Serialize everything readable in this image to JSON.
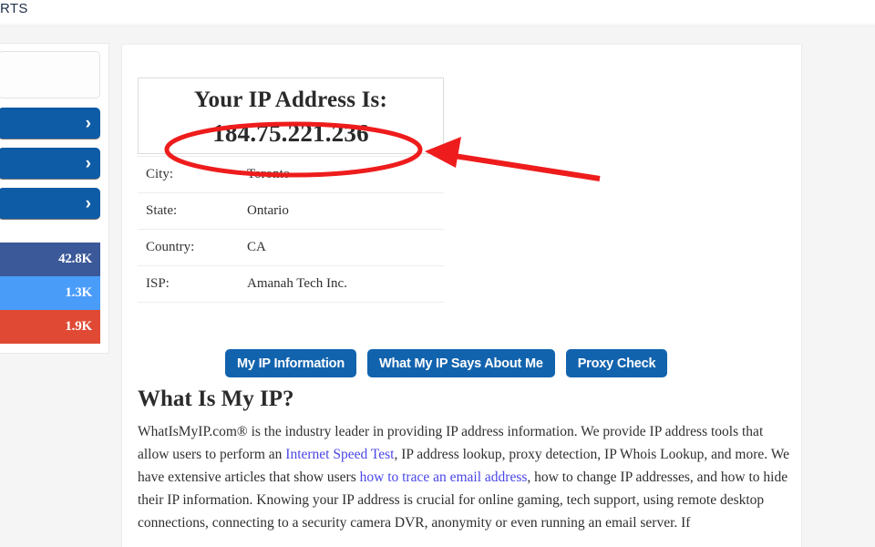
{
  "topbar": {
    "text": "RTS"
  },
  "sidebar": {
    "ad_placeholder": "",
    "nav_buttons": [
      {
        "label": "",
        "chevron": "›"
      },
      {
        "label": "",
        "chevron": "›"
      },
      {
        "label": "",
        "chevron": "›"
      }
    ],
    "social": [
      {
        "name": "",
        "count": "42.8K",
        "color": "#3b5998"
      },
      {
        "name": "",
        "count": "1.3K",
        "color": "#4a9cf9"
      },
      {
        "name": "",
        "count": "1.9K",
        "color": "#e04a35"
      }
    ]
  },
  "ip_card": {
    "title": "Your IP Address Is:",
    "address": "184.75.221.236"
  },
  "info": {
    "rows": [
      {
        "key": "City:",
        "value": "Toronto"
      },
      {
        "key": "State:",
        "value": "Ontario"
      },
      {
        "key": "Country:",
        "value": "CA"
      },
      {
        "key": "ISP:",
        "value": "Amanah Tech Inc."
      }
    ]
  },
  "actions": [
    {
      "label": "My IP Information"
    },
    {
      "label": "What My IP Says About Me"
    },
    {
      "label": "Proxy Check"
    }
  ],
  "article": {
    "heading": "What Is My IP?",
    "part1": "WhatIsMyIP.com® is the industry leader in providing IP address information. We provide IP address tools that allow users to perform an ",
    "link1": "Internet Speed Test",
    "part2": ", IP address lookup, proxy detection, IP Whois Lookup, and more. We have extensive articles that show users ",
    "link2": "how to trace an email address",
    "part3": ", how to change IP addresses, and how to hide their IP information. Knowing your IP address is crucial for online gaming, tech support, using remote desktop connections, connecting to a security camera DVR, anonymity or even running an email server. If"
  },
  "annotation": {
    "highlight_color": "#ee1c1c",
    "shape": "ellipse-around-ip",
    "arrow": "arrow-pointing-left-at-ip"
  },
  "colors": {
    "button_blue": "#1263ae",
    "nav_blue": "#0e5ba6",
    "link_blue": "#4a46e8",
    "page_bg": "#f5f5f5"
  }
}
